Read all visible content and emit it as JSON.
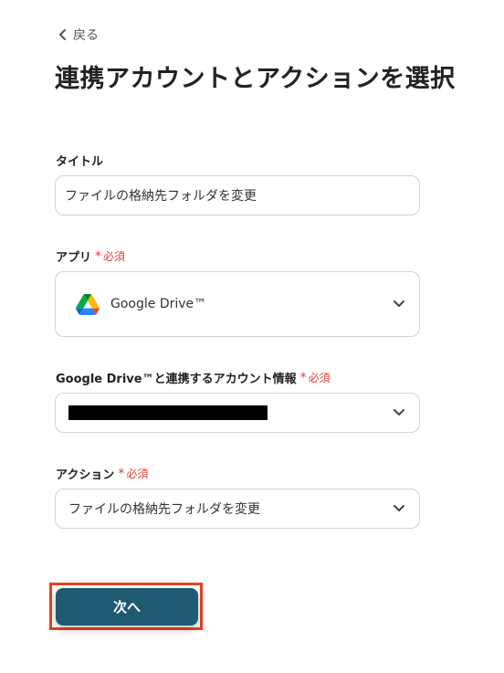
{
  "header": {
    "back_label": "戻る",
    "title": "連携アカウントとアクションを選択"
  },
  "form": {
    "title_field": {
      "label": "タイトル",
      "value": "ファイルの格納先フォルダを変更"
    },
    "app_field": {
      "label": "アプリ",
      "required_label": "必須",
      "value": "Google Drive™",
      "icon": "google-drive-icon"
    },
    "account_field": {
      "label": "Google Drive™と連携するアカウント情報",
      "required_label": "必須",
      "value": ""
    },
    "action_field": {
      "label": "アクション",
      "required_label": "必須",
      "value": "ファイルの格納先フォルダを変更"
    }
  },
  "footer": {
    "next_label": "次へ"
  },
  "colors": {
    "accent": "#205a72",
    "required": "#e0423b",
    "highlight": "#e8431f"
  }
}
